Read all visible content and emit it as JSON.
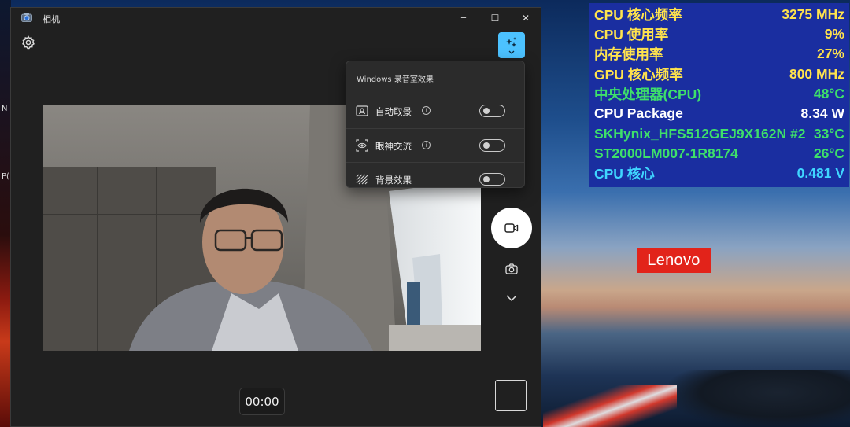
{
  "window": {
    "title": "相机"
  },
  "window_buttons": {
    "minimize": "─",
    "maximize": "☐",
    "close": "✕"
  },
  "effects_panel": {
    "title": "Windows 录音室效果",
    "items": [
      {
        "label": "自动取景",
        "has_info": true,
        "on": false
      },
      {
        "label": "眼神交流",
        "has_info": true,
        "on": false
      },
      {
        "label": "背景效果",
        "has_info": false,
        "on": false
      }
    ],
    "info_glyph": "i"
  },
  "timer": {
    "value": "00:00"
  },
  "hw_monitor": {
    "rows": [
      {
        "label": "CPU 核心频率",
        "value": "3275 MHz",
        "color": "#ffe34d"
      },
      {
        "label": "CPU 使用率",
        "value": "9%",
        "color": "#ffe34d"
      },
      {
        "label": "内存使用率",
        "value": "27%",
        "color": "#ffe34d"
      },
      {
        "label": "GPU 核心频率",
        "value": "800 MHz",
        "color": "#ffe34d"
      },
      {
        "label": "中央处理器(CPU)",
        "value": "48°C",
        "color": "#3ee06a"
      },
      {
        "label": "CPU Package",
        "value": "8.34 W",
        "color": "#ffffff"
      },
      {
        "label": "SKHynix_HFS512GEJ9X162N #2",
        "value": "33°C",
        "color": "#3ee06a"
      },
      {
        "label": "ST2000LM007-1R8174",
        "value": "26°C",
        "color": "#3ee06a"
      },
      {
        "label": "CPU 核心",
        "value": "0.481 V",
        "color": "#3fd6ff"
      }
    ]
  },
  "desktop": {
    "brand_logo": "Lenovo",
    "left_labels": [
      "N",
      "P("
    ]
  },
  "colors": {
    "accent": "#4cc2ff",
    "window_bg": "#202020",
    "panel_bg": "#2b2b2b",
    "lenovo_red": "#e2231a"
  }
}
